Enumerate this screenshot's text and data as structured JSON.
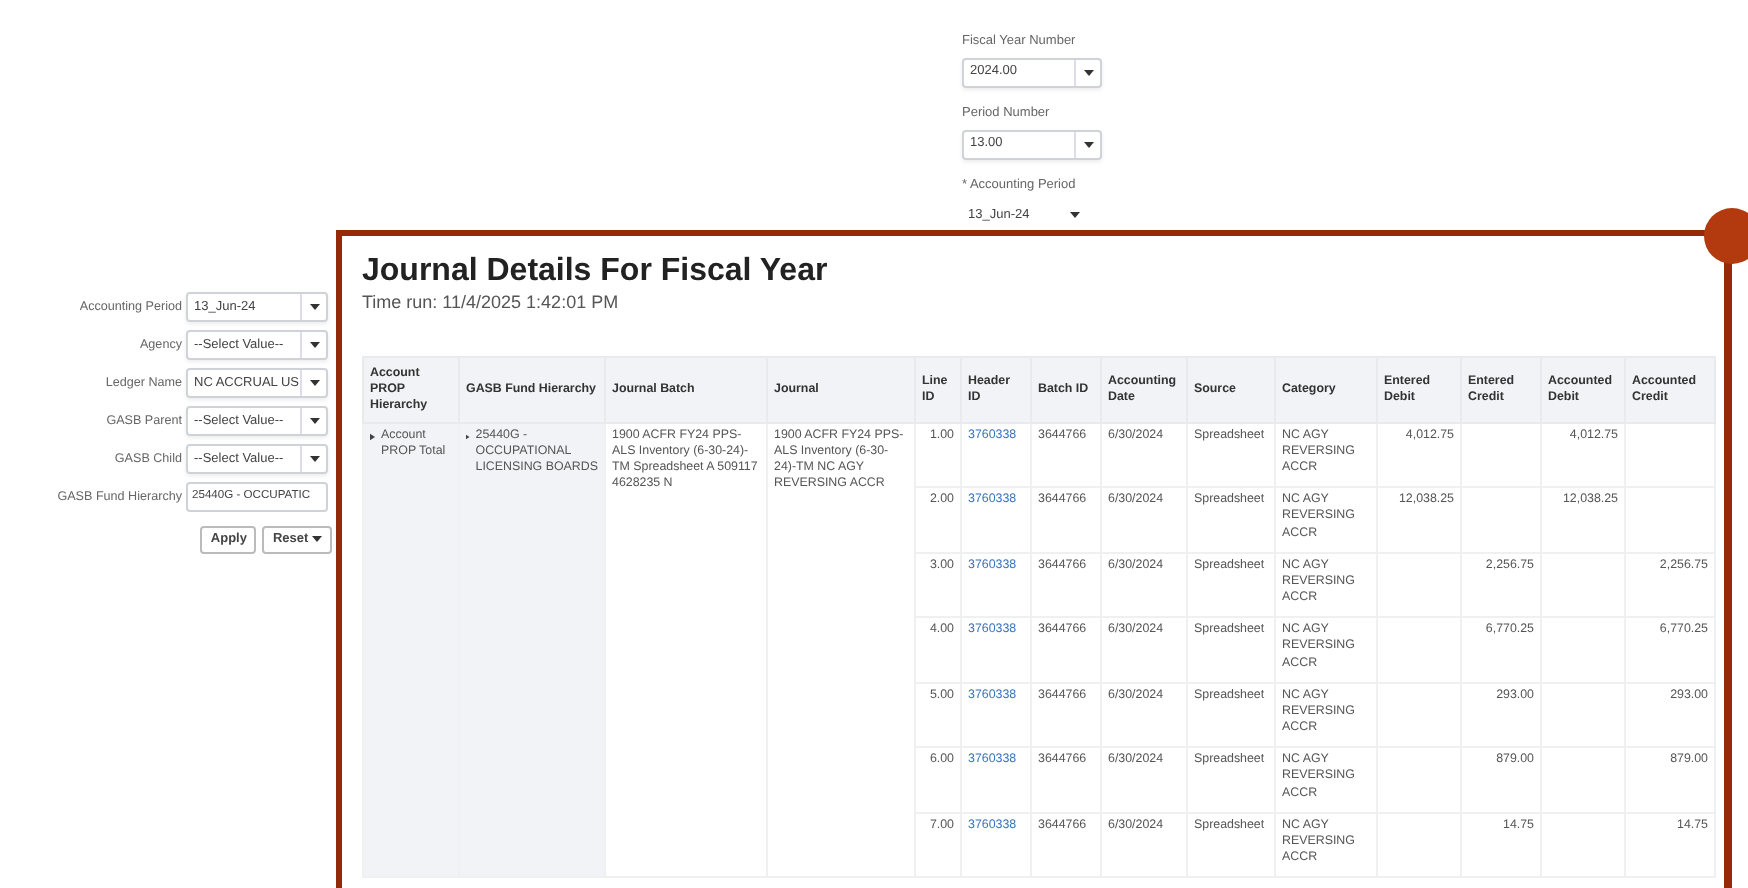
{
  "top_prompts": [
    {
      "label": "Fiscal Year Number",
      "value": "2024.00",
      "kind": "select"
    },
    {
      "label": "Period Number",
      "value": "13.00",
      "kind": "select"
    },
    {
      "label": "* Accounting Period",
      "value": "13_Jun-24",
      "kind": "plain"
    }
  ],
  "left_prompts": [
    {
      "label": "Accounting Period",
      "value": "13_Jun-24",
      "kind": "select"
    },
    {
      "label": "Agency",
      "value": "--Select Value--",
      "kind": "select"
    },
    {
      "label": "Ledger Name",
      "value": "NC ACCRUAL US",
      "kind": "select"
    },
    {
      "label": "GASB Parent",
      "value": "--Select Value--",
      "kind": "select"
    },
    {
      "label": "GASB Child",
      "value": "--Select Value--",
      "kind": "select"
    },
    {
      "label": "GASB Fund Hierarchy",
      "value": "25440G - OCCUPATIC",
      "kind": "text"
    }
  ],
  "buttons": [
    {
      "label": "Apply",
      "dropdown": false
    },
    {
      "label": "Reset",
      "dropdown": true
    }
  ],
  "report": {
    "title": "Journal Details For Fiscal Year",
    "time_run": "Time run: 11/4/2025 1:42:01 PM",
    "columns": [
      "Account PROP Hierarchy",
      "GASB Fund Hierarchy",
      "Journal Batch",
      "Journal",
      "Line ID",
      "Header ID",
      "Batch ID",
      "Accounting Date",
      "Source",
      "Category",
      "Entered Debit",
      "Entered Credit",
      "Accounted Debit",
      "Accounted Credit"
    ],
    "group": {
      "account": "Account PROP Total",
      "gasb_fund": "25440G - OCCUPATIONAL LICENSING BOARDS",
      "journal_batch": "1900 ACFR FY24 PPS-ALS Inventory (6-30-24)-TM Spreadsheet A 509117 4628235 N",
      "journal": "1900 ACFR FY24 PPS-ALS Inventory (6-30-24)-TM NC AGY REVERSING ACCR"
    },
    "rows": [
      {
        "line_id": "1.00",
        "header_id": "3760338",
        "batch_id": "3644766",
        "date": "6/30/2024",
        "source": "Spreadsheet",
        "category": "NC AGY REVERSING ACCR",
        "entered_debit": "4,012.75",
        "accounted_debit": "4,012.75"
      },
      {
        "line_id": "2.00",
        "header_id": "3760338",
        "batch_id": "3644766",
        "date": "6/30/2024",
        "source": "Spreadsheet",
        "category": "NC AGY REVERSING ACCR",
        "entered_debit": "12,038.25",
        "accounted_debit": "12,038.25"
      },
      {
        "line_id": "3.00",
        "header_id": "3760338",
        "batch_id": "3644766",
        "date": "6/30/2024",
        "source": "Spreadsheet",
        "category": "NC AGY REVERSING ACCR",
        "entered_credit": "2,256.75",
        "accounted_credit": "2,256.75"
      },
      {
        "line_id": "4.00",
        "header_id": "3760338",
        "batch_id": "3644766",
        "date": "6/30/2024",
        "source": "Spreadsheet",
        "category": "NC AGY REVERSING ACCR",
        "entered_credit": "6,770.25",
        "accounted_credit": "6,770.25"
      },
      {
        "line_id": "5.00",
        "header_id": "3760338",
        "batch_id": "3644766",
        "date": "6/30/2024",
        "source": "Spreadsheet",
        "category": "NC AGY REVERSING ACCR",
        "entered_credit": "293.00",
        "accounted_credit": "293.00"
      },
      {
        "line_id": "6.00",
        "header_id": "3760338",
        "batch_id": "3644766",
        "date": "6/30/2024",
        "source": "Spreadsheet",
        "category": "NC AGY REVERSING ACCR",
        "entered_credit": "879.00",
        "accounted_credit": "879.00"
      },
      {
        "line_id": "7.00",
        "header_id": "3760338",
        "batch_id": "3644766",
        "date": "6/30/2024",
        "source": "Spreadsheet",
        "category": "NC AGY REVERSING ACCR",
        "entered_credit": "14.75",
        "accounted_credit": "14.75"
      }
    ]
  }
}
